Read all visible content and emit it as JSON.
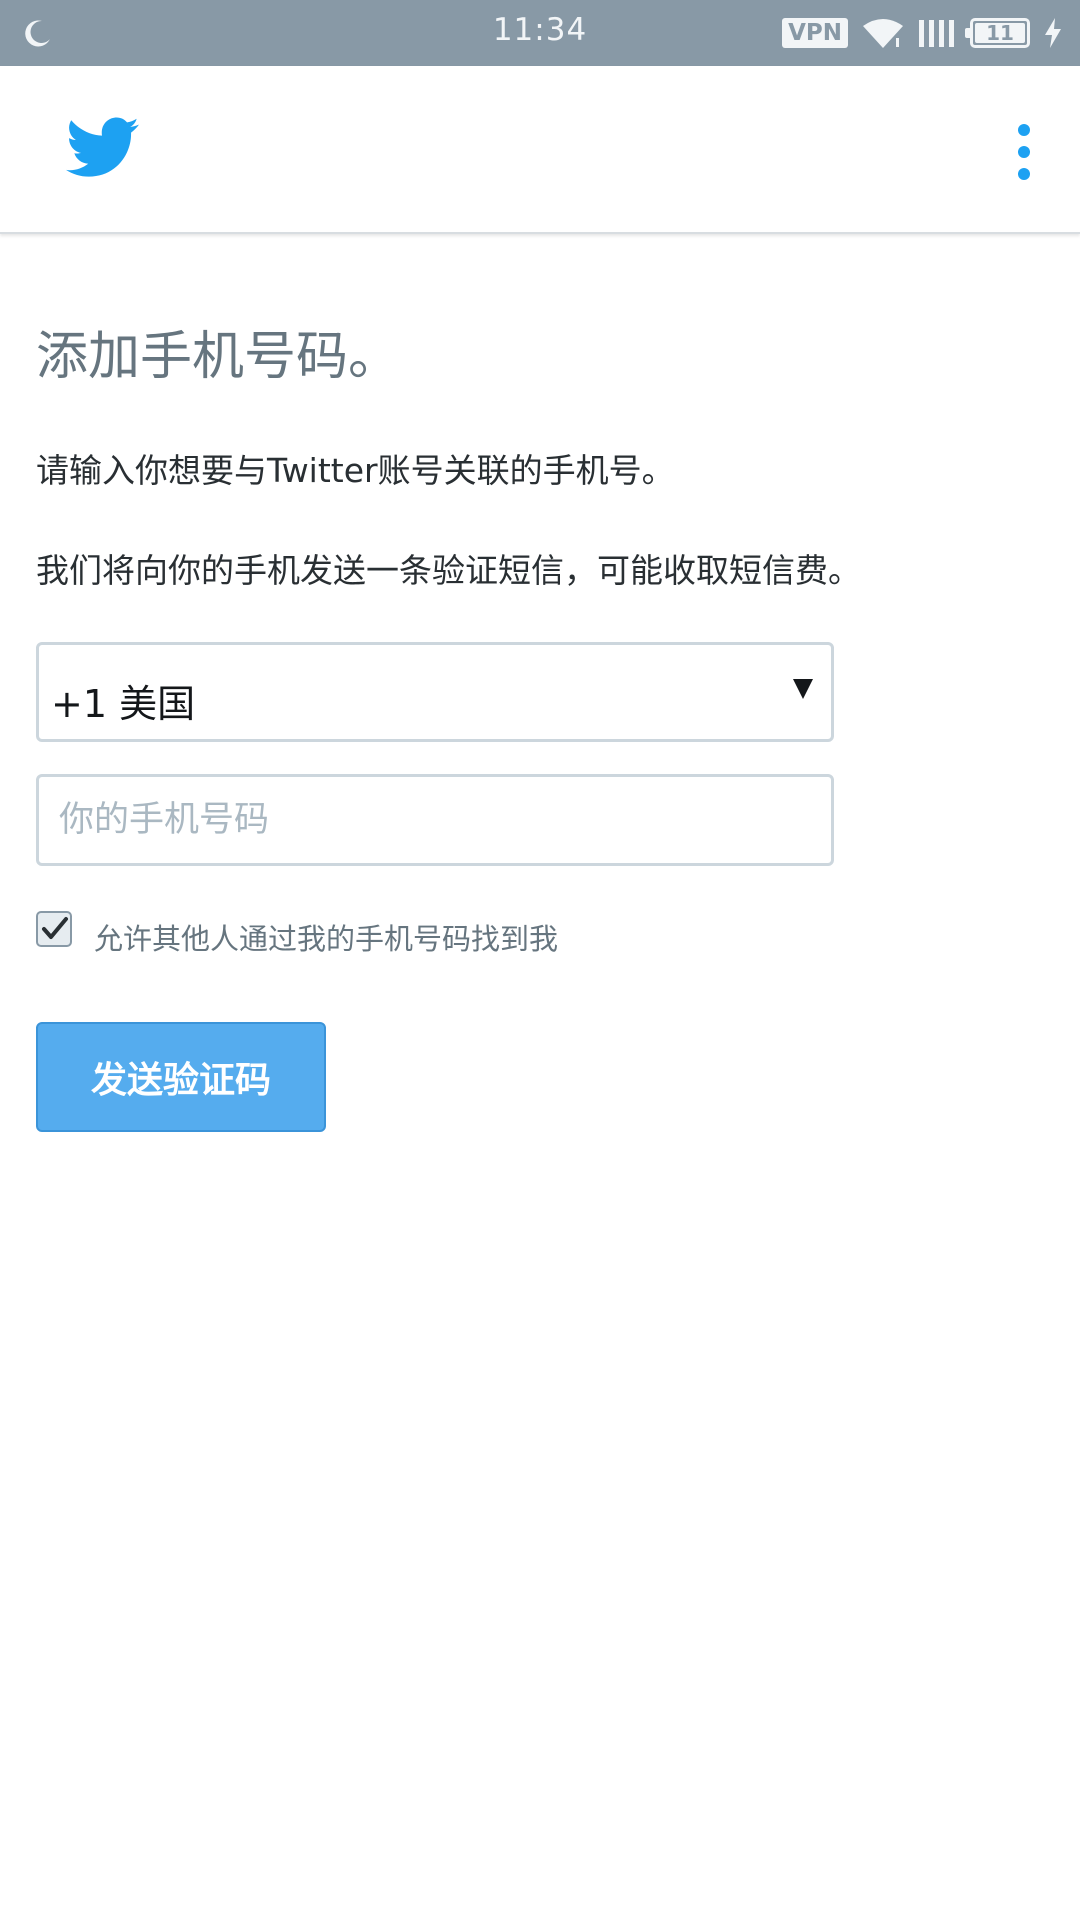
{
  "status_bar": {
    "time": "11:34",
    "vpn_label": "VPN",
    "battery_level": "11",
    "icons": [
      "moon-icon",
      "vpn-badge",
      "wifi-icon",
      "signal-icon",
      "battery-icon",
      "charging-icon"
    ]
  },
  "app_bar": {
    "logo": "twitter-bird-icon",
    "menu": "more-vertical-icon",
    "accent_color": "#1da1f2"
  },
  "form": {
    "title": "添加手机号码。",
    "description_1": "请输入你想要与Twitter账号关联的手机号。",
    "description_2": "我们将向你的手机发送一条验证短信，可能收取短信费。",
    "country_select_value": "+1 美国",
    "phone_placeholder": "你的手机号码",
    "phone_value": "",
    "discoverable_checked": true,
    "discoverable_label": "允许其他人通过我的手机号码找到我",
    "send_button_label": "发送验证码",
    "button_color": "#55acee"
  }
}
